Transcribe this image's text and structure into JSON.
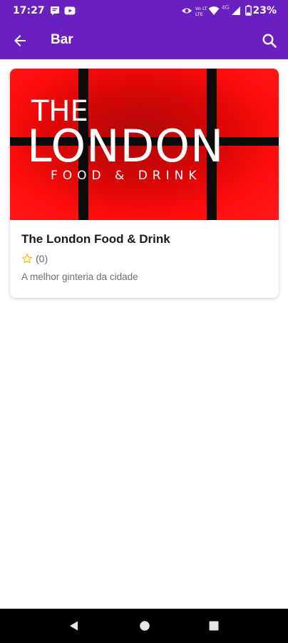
{
  "status_bar": {
    "time": "17:27",
    "battery": "23%",
    "icons": [
      "message-icon",
      "youtube-icon",
      "eye-icon",
      "volte-icon",
      "wifi-icon",
      "4g-icon",
      "signal-icon",
      "battery-icon"
    ],
    "network_label": "4G",
    "volte_label": "Vo LTE"
  },
  "app_bar": {
    "title": "Bar",
    "back_icon": "arrow-back-icon",
    "search_icon": "search-icon",
    "color": "#6a1fbf"
  },
  "listing": {
    "image_logo": {
      "line1": "THE",
      "line2": "LONDON",
      "line3": "FOOD & DRINK"
    },
    "name": "The London Food & Drink",
    "rating_count": "(0)",
    "description": "A melhor ginteria da cidade",
    "star_color": "#f2c200"
  },
  "nav_bar": {
    "buttons": [
      "back-triangle-icon",
      "home-circle-icon",
      "recents-square-icon"
    ]
  }
}
